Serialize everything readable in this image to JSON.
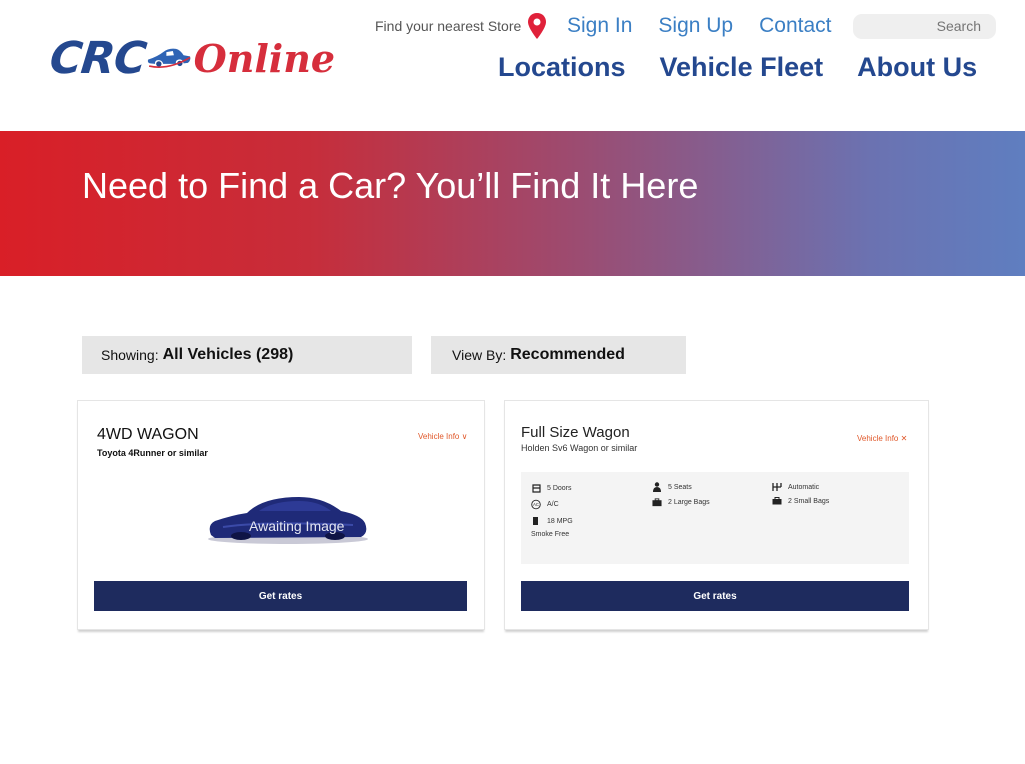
{
  "brand": {
    "logo_left": "CRC",
    "logo_right": "Online"
  },
  "header": {
    "store_finder": "Find your nearest Store",
    "top_links": [
      "Sign In",
      "Sign Up",
      "Contact"
    ],
    "search_placeholder": "Search",
    "main_nav": [
      "Locations",
      "Vehicle Fleet",
      "About Us"
    ]
  },
  "hero": {
    "title": "Need to Find a Car? You’ll Find It Here"
  },
  "filters": {
    "showing_label": "Showing:",
    "showing_value": "All Vehicles (298)",
    "view_label": "View By:",
    "view_value": "Recommended"
  },
  "cards": [
    {
      "title": "4WD WAGON",
      "subtitle": "Toyota 4Runner or similar",
      "vehicle_info": "Vehicle Info ∨",
      "image_text": "Awaiting Image",
      "button": "Get rates"
    },
    {
      "title": "Full Size Wagon",
      "subtitle": "Holden Sv6 Wagon or similar",
      "vehicle_info": "Vehicle Info ✕",
      "specs": {
        "doors": "5 Doors",
        "ac": "A/C",
        "mpg": "18 MPG",
        "smoke": "Smoke Free",
        "seats": "5 Seats",
        "large_bags": "2 Large Bags",
        "transmission": "Automatic",
        "small_bags": "2 Small Bags"
      },
      "button": "Get rates"
    }
  ],
  "colors": {
    "brand_blue": "#24488f",
    "brand_red": "#d62e3c",
    "link_blue": "#3b7fc4",
    "button_navy": "#1e2b5e",
    "accent_orange": "#e0582a"
  }
}
